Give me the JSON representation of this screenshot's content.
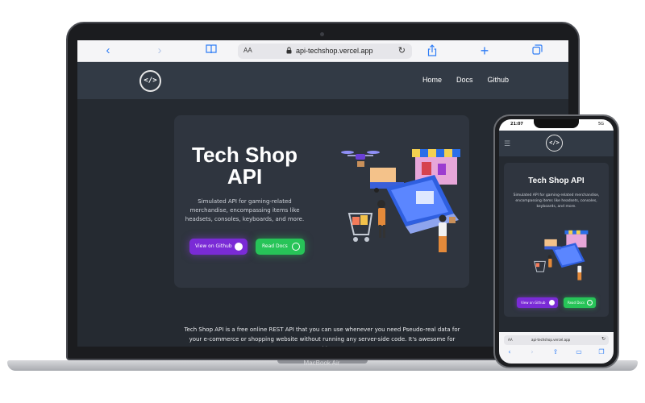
{
  "laptop": {
    "brand_label": "MacBook Air",
    "browser": {
      "address_aa": "AA",
      "url": "api-techshop.vercel.app",
      "icons": [
        "chevron-left-icon",
        "chevron-right-icon",
        "bookmarks-icon",
        "reload-icon",
        "share-icon",
        "plus-icon",
        "tabs-icon"
      ],
      "accent_color": "#2f7df6"
    },
    "site": {
      "logo": "</>",
      "nav": [
        "Home",
        "Docs",
        "Github"
      ],
      "hero": {
        "title": "Tech Shop API",
        "subtitle": "Simulated API for gaming-related merchandise, encompassing items like headsets, consoles, keyboards, and more.",
        "github_button": "View on Github",
        "docs_button": "Read Docs"
      },
      "description": "Tech Shop API is a free online REST API that you can use whenever you need Pseudo-real data for your e-commerce or shopping website without running any server-side code. It's awesome for teaching"
    },
    "colors": {
      "page_bg": "#252a31",
      "nav_bg": "#323a45",
      "card_bg": "#2f353f",
      "github_purple": "#7a2bd6",
      "docs_green": "#27c458"
    }
  },
  "phone": {
    "status_time": "21:07",
    "status_signal": "5G",
    "logo": "</>",
    "hero": {
      "title": "Tech Shop API",
      "subtitle": "Simulated API for gaming-related merchandise, encompassing items like headsets, consoles, keyboards, and more.",
      "github_button": "View on Github",
      "docs_button": "Read Docs"
    },
    "browser": {
      "address_aa": "AA",
      "url": "api-techshop.vercel.app"
    }
  }
}
